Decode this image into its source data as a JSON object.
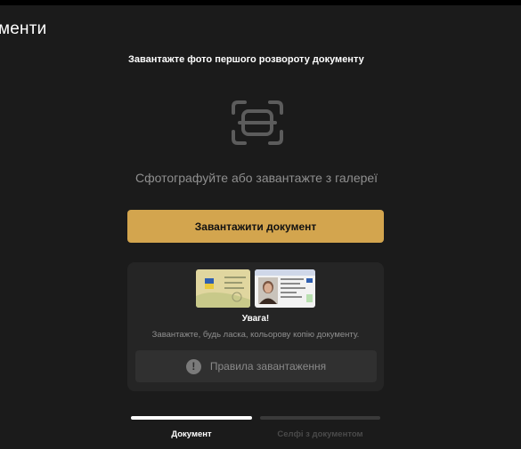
{
  "header": {
    "title": "менти"
  },
  "upload": {
    "heading": "Завантажте фото першого розвороту документу",
    "hint": "Сфотографуйте або завантажте з галереї",
    "button_label": "Завантажити документ"
  },
  "warning": {
    "title": "Увага!",
    "text": "Завантажте, будь ласка, кольорову копію документу.",
    "rules_label": "Правила завантаження",
    "rules_icon": "!"
  },
  "steps": [
    {
      "label": "Документ",
      "active": true
    },
    {
      "label": "Селфі з документом",
      "active": false
    }
  ],
  "colors": {
    "background": "#1b1b1b",
    "accent": "#d3a54e",
    "card": "#252525"
  }
}
